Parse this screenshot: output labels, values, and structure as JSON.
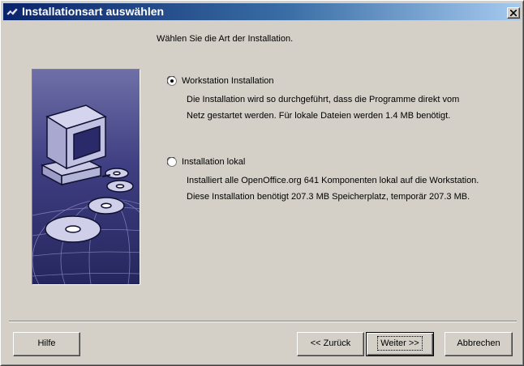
{
  "window": {
    "title": "Installationsart auswählen",
    "close_glyph": "✕"
  },
  "prompt": "Wählen Sie die Art der Installation.",
  "options": [
    {
      "label": "Workstation Installation",
      "selected": true,
      "description": [
        "Die Installation wird so durchgeführt, dass die Programme direkt vom",
        "Netz gestartet werden. Für lokale Dateien werden 1.4 MB benötigt."
      ]
    },
    {
      "label": "Installation lokal",
      "selected": false,
      "description": [
        "Installiert alle OpenOffice.org 641 Komponenten lokal auf die Workstation.",
        "Diese Installation benötigt 207.3 MB Speicherplatz, temporär 207.3 MB."
      ]
    }
  ],
  "buttons": {
    "help": "Hilfe",
    "back": "<< Zurück",
    "next": "Weiter >>",
    "cancel": "Abbrechen"
  },
  "colors": {
    "titlebar_start": "#0a246a",
    "titlebar_end": "#a6caf0",
    "face": "#d4d0c8",
    "illustration_bg": "#3a3a7a"
  },
  "icons": [
    "app-icon",
    "close-icon",
    "computer-illustration",
    "radio-selected-icon",
    "radio-unselected-icon"
  ]
}
